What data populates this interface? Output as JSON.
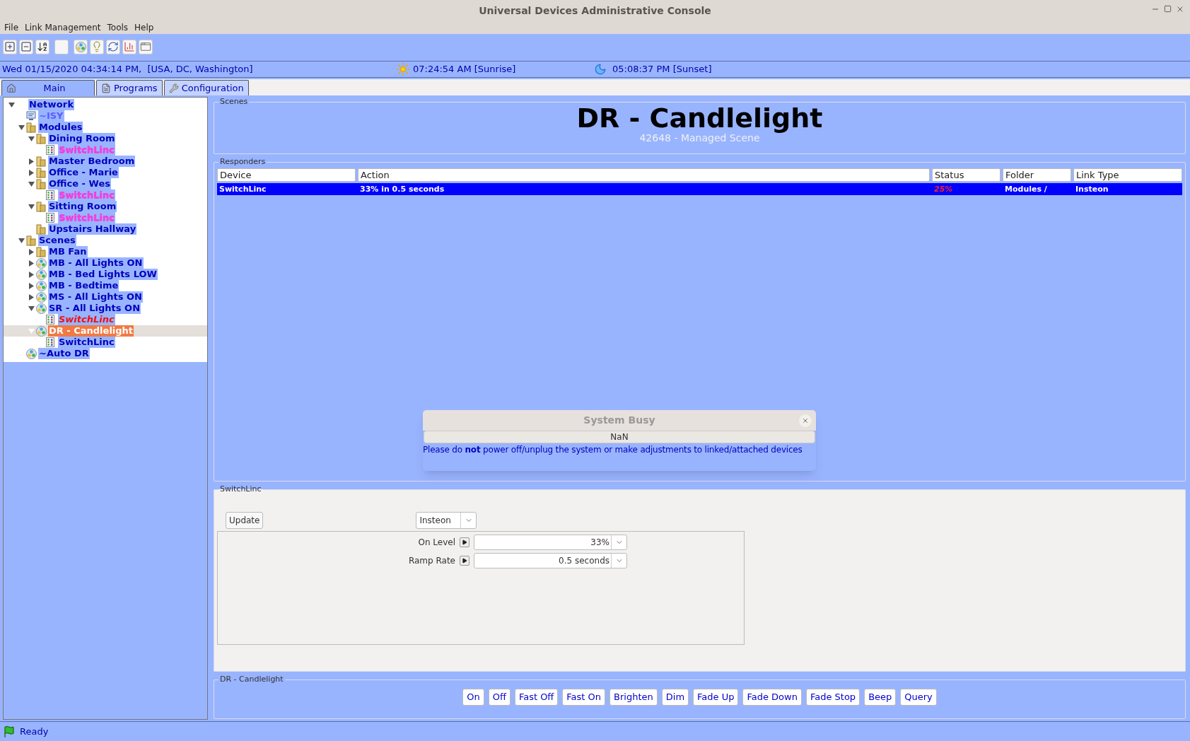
{
  "window": {
    "title": "Universal Devices Administrative Console"
  },
  "menu": [
    "File",
    "Link Management",
    "Tools",
    "Help"
  ],
  "toolbar": [
    {
      "kind": "expand"
    },
    {
      "kind": "collapse"
    },
    {
      "kind": "sort"
    },
    {
      "kind": "blank"
    },
    {
      "kind": "scene"
    },
    {
      "kind": "bulb"
    },
    {
      "kind": "swap"
    },
    {
      "kind": "chart"
    },
    {
      "kind": "window"
    }
  ],
  "info_bar": {
    "datetime": "Wed 01/15/2020 04:34:14 PM,  [USA, DC, Washington]",
    "sunrise": "07:24:54 AM [Sunrise]",
    "sunset": "05:08:37 PM [Sunset]"
  },
  "tabs": [
    {
      "label": "Main",
      "kind": "home",
      "selected": true
    },
    {
      "label": "Programs",
      "kind": "programs",
      "selected": false
    },
    {
      "label": "Configuration",
      "kind": "config",
      "selected": false
    }
  ],
  "tree": [
    {
      "label": "Network",
      "kind": "network",
      "expanded": true,
      "selected": false,
      "children": [
        {
          "label": "~ISY",
          "kind": "isy",
          "selected": false
        },
        {
          "label": "Modules",
          "kind": "folder",
          "expanded": true,
          "selected": false,
          "children": [
            {
              "label": "Dining Room",
              "kind": "folder",
              "expanded": true,
              "selected": false,
              "children": [
                {
                  "label": "SwitchLinc",
                  "kind": "device",
                  "color": "#ee44dd",
                  "italic": false,
                  "selected": false
                }
              ]
            },
            {
              "label": "Master Bedroom",
              "kind": "folder",
              "expanded": false,
              "selected": false
            },
            {
              "label": "Office - Marie",
              "kind": "folder",
              "expanded": false,
              "selected": false
            },
            {
              "label": "Office - Wes",
              "kind": "folder",
              "expanded": true,
              "selected": false,
              "children": [
                {
                  "label": "SwitchLinc",
                  "kind": "device",
                  "color": "#ee44dd",
                  "italic": false,
                  "selected": false
                }
              ]
            },
            {
              "label": "Sitting Room",
              "kind": "folder",
              "expanded": true,
              "selected": false,
              "children": [
                {
                  "label": "SwitchLinc",
                  "kind": "device",
                  "color": "#ee44dd",
                  "italic": false,
                  "selected": false
                }
              ]
            },
            {
              "label": "Upstairs Hallway",
              "kind": "folder",
              "selected": false
            }
          ]
        },
        {
          "label": "Scenes",
          "kind": "folder",
          "expanded": true,
          "selected": false,
          "children": [
            {
              "label": "MB Fan",
              "kind": "folder",
              "expanded": false,
              "selected": false
            },
            {
              "label": "MB - All Lights ON",
              "kind": "scene",
              "expanded": false,
              "selected": false
            },
            {
              "label": "MB - Bed Lights LOW",
              "kind": "scene",
              "expanded": false,
              "selected": false
            },
            {
              "label": "MB - Bedtime",
              "kind": "scene",
              "expanded": false,
              "selected": false
            },
            {
              "label": "MS - All Lights ON",
              "kind": "scene",
              "expanded": false,
              "selected": false
            },
            {
              "label": "SR - All Lights ON",
              "kind": "scene",
              "expanded": true,
              "selected": false,
              "children": [
                {
                  "label": "SwitchLinc",
                  "kind": "device",
                  "italic": true,
                  "selected": false
                }
              ]
            },
            {
              "label": "DR - Candlelight",
              "kind": "scene",
              "expanded": true,
              "selected": true,
              "children": [
                {
                  "label": "SwitchLinc",
                  "kind": "device",
                  "italic": false,
                  "selected": false
                }
              ]
            }
          ]
        },
        {
          "label": "~Auto DR",
          "kind": "scene",
          "selected": false
        }
      ]
    }
  ],
  "scene": {
    "group_label": "Scenes",
    "title": "DR - Candlelight",
    "subtitle": "42648 - Managed Scene"
  },
  "responders": {
    "group_label": "Responders",
    "columns": [
      "Device",
      "Action",
      "Status",
      "Folder",
      "Link Type"
    ],
    "rows": [
      {
        "device": "SwitchLinc",
        "action": "33% in 0.5 seconds",
        "status": "25%",
        "folder": "Modules /",
        "link_type": "Insteon",
        "selected": true
      }
    ]
  },
  "device_panel": {
    "group_label": "SwitchLinc",
    "update_button": "Update",
    "link_type": "Insteon",
    "fields": [
      {
        "label": "On Level",
        "value": "33%"
      },
      {
        "label": "Ramp Rate",
        "value": "0.5 seconds"
      }
    ]
  },
  "command_panel": {
    "group_label": "DR - Candlelight",
    "buttons": [
      "On",
      "Off",
      "Fast Off",
      "Fast On",
      "Brighten",
      "Dim",
      "Fade Up",
      "Fade Down",
      "Fade Stop",
      "Beep",
      "Query"
    ]
  },
  "dialog": {
    "title": "System Busy",
    "progress_text": "NaN",
    "level": 0,
    "message": "Please do **not** power off/unplug the system or make adjustments to linked/attached devices"
  },
  "status_bar": {
    "text": "Ready"
  }
}
